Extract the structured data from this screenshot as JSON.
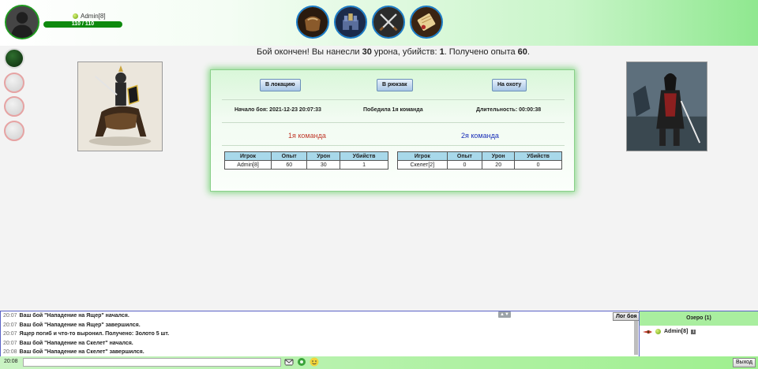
{
  "header": {
    "player_name": "Admin[8]",
    "hp_text": "110 / 110",
    "nav_icons": [
      "inventory-bag-icon",
      "castle-icon",
      "crossed-swords-icon",
      "scroll-icon"
    ]
  },
  "battle": {
    "result_prefix": "Бой окончен! Вы нанесли ",
    "damage": "30",
    "result_mid1": " урона, убийств: ",
    "kills": "1",
    "result_mid2": ". Получено опыта ",
    "exp": "60",
    "result_suffix": ".",
    "buttons": {
      "location": "В локацию",
      "backpack": "В рюкзак",
      "hunt": "На охоту"
    },
    "start_label": "Начало боя: 2021-12-23 20:07:33",
    "winner_label": "Победила 1я команда",
    "duration_label": "Длительность: 00:00:38",
    "team1_title": "1я команда",
    "team2_title": "2я команда",
    "team1_color": "#c0392b",
    "team2_color": "#1a2fb8",
    "table_headers": [
      "Игрок",
      "Опыт",
      "Урон",
      "Убийств"
    ],
    "team1_rows": [
      [
        "Admin[8]",
        "60",
        "30",
        "1"
      ]
    ],
    "team2_rows": [
      [
        "Скелет[2]",
        "0",
        "20",
        "0"
      ]
    ]
  },
  "chat": {
    "log_button": "Лог боя",
    "lines": [
      {
        "time": "20:07",
        "text": "Ваш бой \"Нападение на Ящер\" начался."
      },
      {
        "time": "20:07",
        "text": "Ваш бой \"Нападение на Ящер\" завершился."
      },
      {
        "time": "20:07",
        "text": "Ящер погиб и что-то выронил. Получено: Золото 5 шт."
      },
      {
        "time": "20:07",
        "text": "Ваш бой \"Нападение на Скелет\" начался."
      },
      {
        "time": "20:08",
        "text": "Ваш бой \"Нападение на Скелет\" завершился."
      }
    ]
  },
  "room": {
    "title": "Озеро (1)",
    "user": "Admin[8]"
  },
  "footer": {
    "clock": "20:08",
    "exit_label": "Выход"
  }
}
